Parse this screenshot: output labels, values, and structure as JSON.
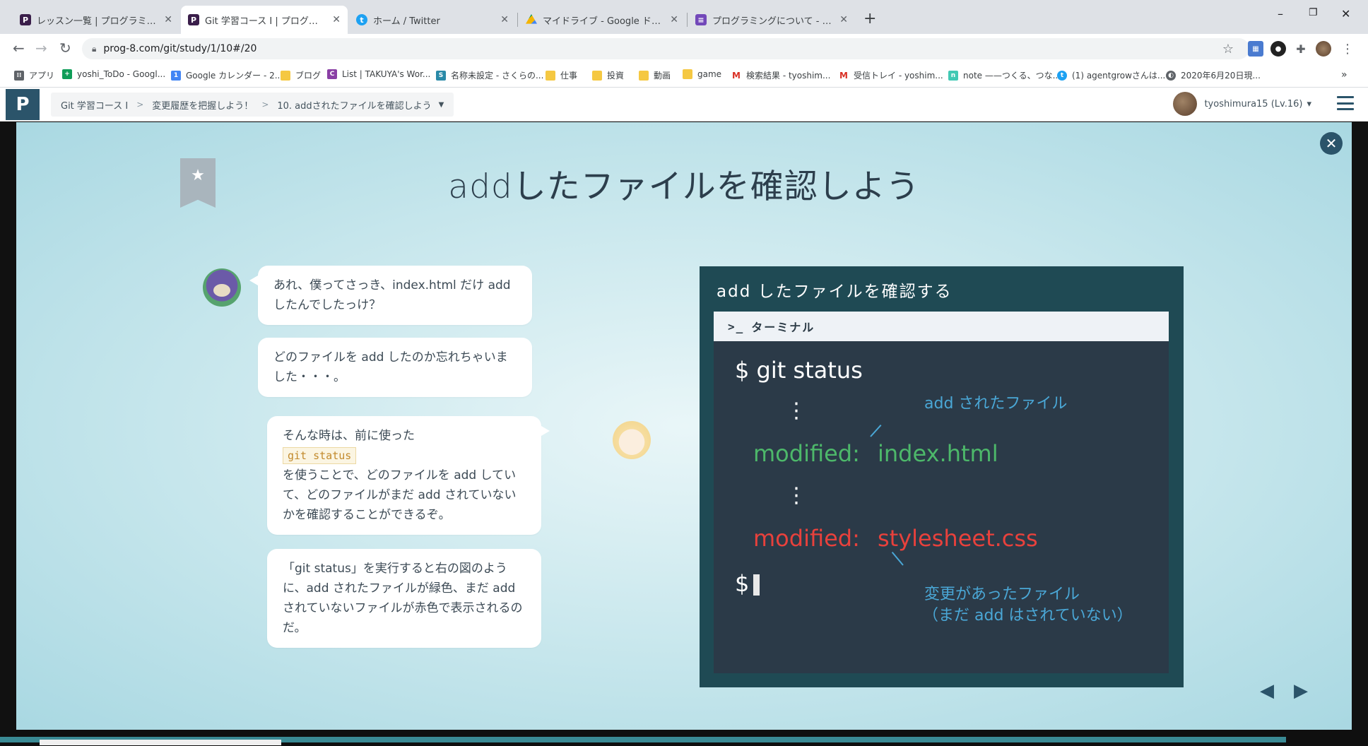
{
  "browser": {
    "tabs": [
      {
        "title": "レッスン一覧 | プログラミングの入門な",
        "close": "✕"
      },
      {
        "title": "Git 学習コース I | プログラミングの入門",
        "close": "✕"
      },
      {
        "title": "ホーム / Twitter",
        "close": "✕"
      },
      {
        "title": "マイドライブ - Google ドライブ",
        "close": "✕"
      },
      {
        "title": "プログラミングについて - Google フォ",
        "close": "✕"
      }
    ],
    "new_tab": "+",
    "url": "prog-8.com/git/study/1/10#/20",
    "bookmarks": [
      "アプリ",
      "yoshi_ToDo - Googl...",
      "Google カレンダー - 2...",
      "ブログ",
      "List | TAKUYA's Wor...",
      "名称未設定 - さくらの...",
      "仕事",
      "投資",
      "動画",
      "game",
      "検索結果 - tyoshim...",
      "受信トレイ - yoshim...",
      "note ——つくる、つな...",
      "(1) agentgrowさんは...",
      "2020年6月20日現..."
    ],
    "bookmarks_overflow": "»"
  },
  "header": {
    "logo": "P",
    "breadcrumb": [
      "Git 学習コース I",
      "変更履歴を把握しよう！",
      "10. addされたファイルを確認しよう"
    ],
    "breadcrumb_sep": ">",
    "breadcrumb_dropdown": "▼",
    "user": "tyoshimura15 (Lv.16)",
    "user_dropdown": "▾"
  },
  "slide": {
    "title": "addしたファイルを確認しよう",
    "close": "✕",
    "star": "★",
    "bubbles": {
      "b1": "あれ、僕ってさっき、index.html だけ add したんでしたっけ？",
      "b2": "どのファイルを add したのか忘れちゃいました・・・。",
      "b3_pre": "そんな時は、前に使った",
      "b3_code": "git status",
      "b3_post": "を使うことで、どのファイルを add していて、どのファイルがまだ add されていないかを確認することができるぞ。",
      "b4": "「git status」を実行すると右の図のように、add されたファイルが緑色、まだ add されていないファイルが赤色で表示されるのだ。"
    },
    "diagram": {
      "title": "add したファイルを確認する",
      "terminal_label": "ターミナル",
      "terminal_icon": ">_",
      "cmd": "$ git status",
      "dots": "⋮",
      "annotation_added": "add されたファイル",
      "modified_label": "modified:",
      "added_file": "index.html",
      "unstaged_file": "stylesheet.css",
      "prompt": "$",
      "annotation_changed_1": "変更があったファイル",
      "annotation_changed_2": "（まだ add はされていない）",
      "colors": {
        "added": "#4db86a",
        "unstaged": "#e8413c",
        "note": "#4aa7d6"
      }
    },
    "nav": {
      "prev": "◀",
      "next": "▶"
    }
  }
}
